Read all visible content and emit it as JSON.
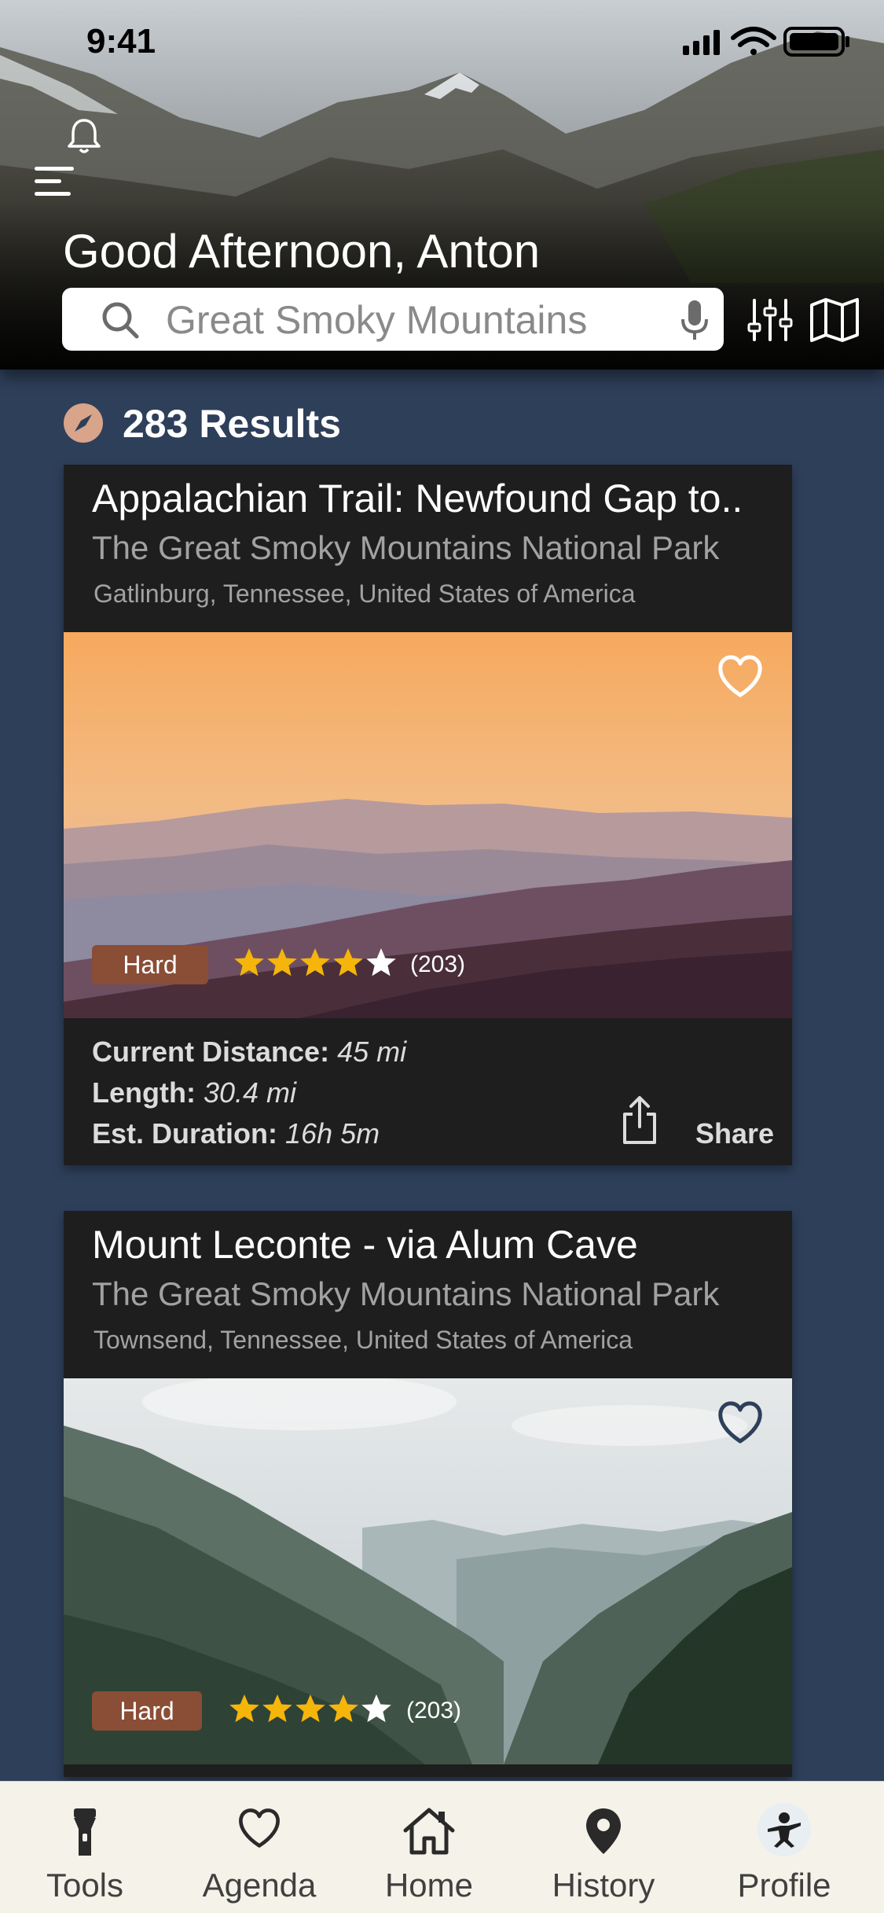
{
  "status_bar": {
    "time": "9:41"
  },
  "header": {
    "greeting": "Good Afternoon, Anton",
    "search": {
      "value": "Great Smoky Mountains"
    }
  },
  "results": {
    "count_label": "283 Results"
  },
  "trails": [
    {
      "title": "Appalachian Trail: Newfound Gap to..",
      "park": "The Great Smoky Mountains National Park",
      "location": "Gatlinburg, Tennessee, United States of America",
      "difficulty": "Hard",
      "rating": 4.5,
      "reviews": "(203)",
      "current_distance_label": "Current Distance:",
      "current_distance": "45 mi",
      "length_label": "Length:",
      "length": "30.4 mi",
      "duration_label": "Est. Duration:",
      "duration": "16h 5m",
      "share_label": "Share"
    },
    {
      "title": "Mount Leconte - via Alum Cave",
      "park": "The Great Smoky Mountains National Park",
      "location": "Townsend, Tennessee, United States of America",
      "difficulty": "Hard",
      "rating": 4.5,
      "reviews": "(203)"
    }
  ],
  "bottom_nav": [
    {
      "label": "Tools",
      "icon": "flashlight-icon"
    },
    {
      "label": "Agenda",
      "icon": "heart-icon"
    },
    {
      "label": "Home",
      "icon": "home-icon"
    },
    {
      "label": "History",
      "icon": "map-pin-icon"
    },
    {
      "label": "Profile",
      "icon": "avatar"
    }
  ],
  "colors": {
    "background": "#2e3f5a",
    "card": "#1e1e1e",
    "difficulty_badge": "#8a4d36",
    "star": "#f5b50a",
    "nav_background": "#f5f2e9"
  }
}
